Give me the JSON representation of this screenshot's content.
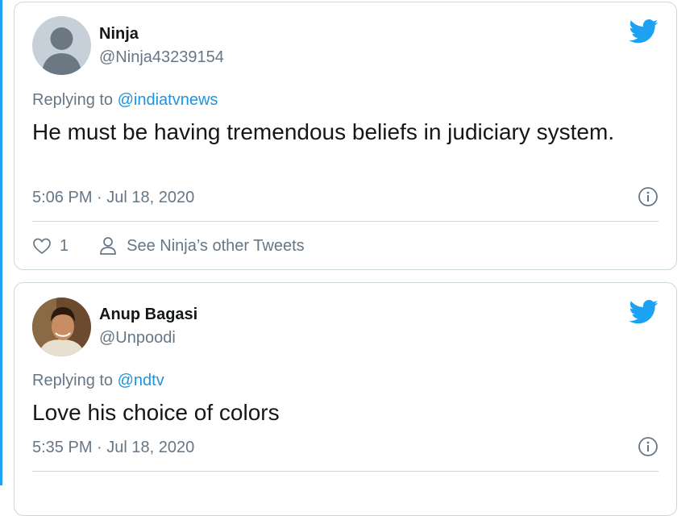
{
  "colors": {
    "accent": "#1da1f2",
    "mention": "#1b95e0",
    "text": "#14171a",
    "muted": "#657786",
    "border": "#ccd6dd"
  },
  "tweets": [
    {
      "name": "Ninja",
      "handle": "@Ninja43239154",
      "replying_prefix": "Replying to ",
      "replying_to": "@indiatvnews",
      "text": "He must be having tremendous beliefs in judiciary system.",
      "timestamp": "5:06 PM · Jul 18, 2020",
      "likes": "1",
      "other_tweets_label": "See Ninja’s other Tweets",
      "avatar": "default-avatar",
      "icons": [
        "twitter-bird-icon",
        "info-icon",
        "heart-icon",
        "person-icon"
      ]
    },
    {
      "name": "Anup Bagasi",
      "handle": "@Unpoodi",
      "replying_prefix": "Replying to ",
      "replying_to": "@ndtv",
      "text": "Love his choice of colors",
      "timestamp": "5:35 PM · Jul 18, 2020",
      "avatar": "profile-photo",
      "icons": [
        "twitter-bird-icon",
        "info-icon"
      ]
    }
  ]
}
